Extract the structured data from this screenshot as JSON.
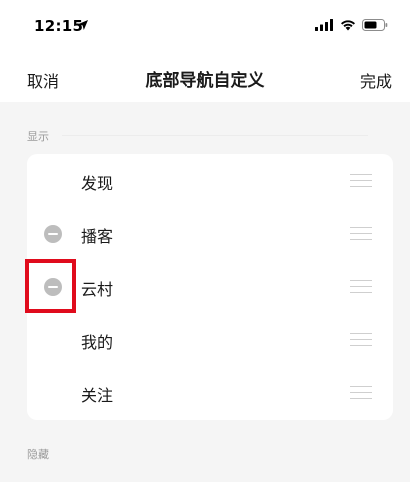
{
  "status": {
    "time": "12:15"
  },
  "nav": {
    "cancel_label": "取消",
    "title": "底部导航自定义",
    "done_label": "完成"
  },
  "sections": {
    "shown_label": "显示",
    "hidden_label": "隐藏"
  },
  "shown_items": [
    {
      "label": "发现",
      "removable": false
    },
    {
      "label": "播客",
      "removable": true
    },
    {
      "label": "云村",
      "removable": true
    },
    {
      "label": "我的",
      "removable": false
    },
    {
      "label": "关注",
      "removable": false
    }
  ],
  "colors": {
    "highlight": "#e00b1c",
    "remove_icon": "#bdbdbd",
    "background": "#f5f5f5"
  }
}
